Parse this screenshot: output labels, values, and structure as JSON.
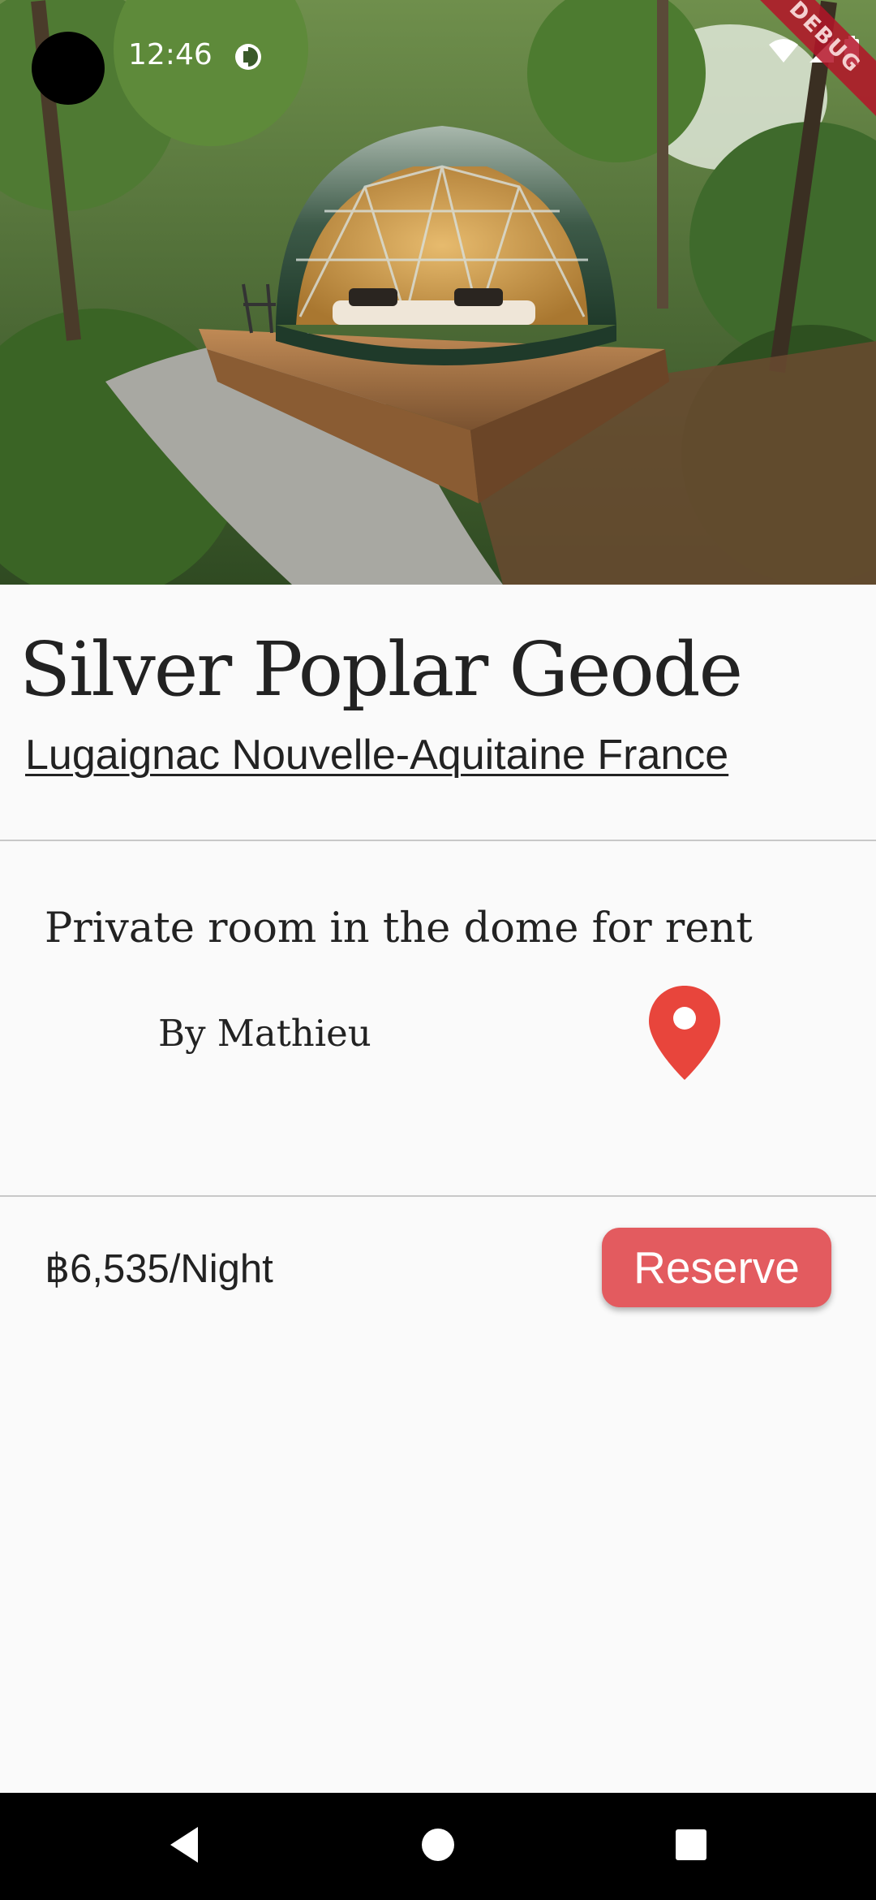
{
  "status_bar": {
    "time": "12:46",
    "debug_label": "DEBUG",
    "icons": [
      "app-notification-icon",
      "wifi-icon",
      "signal-icon",
      "battery-icon"
    ]
  },
  "hero": {
    "image_subject": "geodesic dome tent on wooden deck in forest"
  },
  "listing": {
    "title": "Silver Poplar Geode",
    "location": "Lugaignac Nouvelle-Aquitaine France",
    "room_description": "Private room in the dome for rent",
    "host": "By Mathieu",
    "price": "฿6,535/Night",
    "reserve_label": "Reserve"
  },
  "colors": {
    "accent": "#e35b5f",
    "pin": "#e8453c",
    "text": "#222222",
    "background": "#fafafa"
  },
  "nav": {
    "icons": [
      "back-icon",
      "home-icon",
      "recents-icon"
    ]
  }
}
